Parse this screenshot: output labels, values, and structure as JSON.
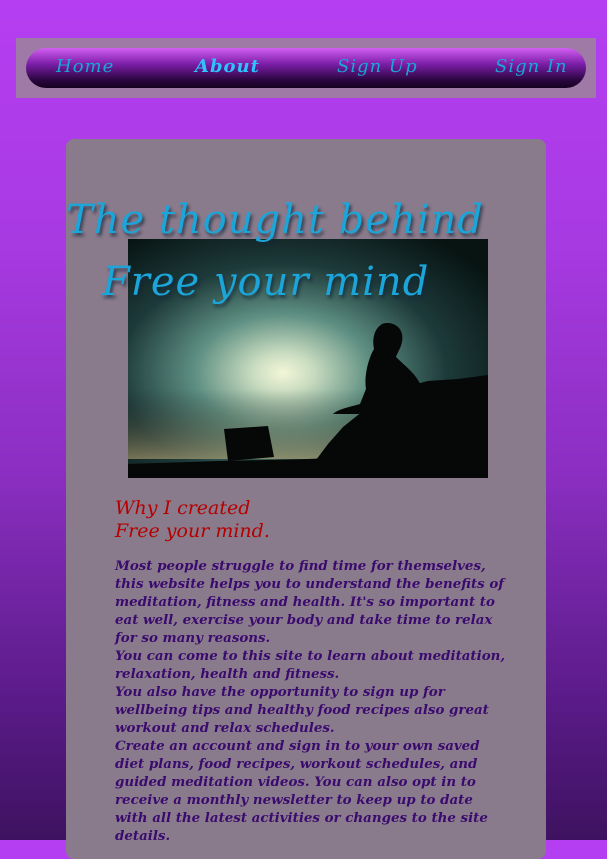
{
  "nav": {
    "items": [
      {
        "label": "Home",
        "active": false
      },
      {
        "label": "About",
        "active": true
      },
      {
        "label": "Sign Up",
        "active": false
      },
      {
        "label": "Sign In",
        "active": false
      }
    ]
  },
  "hero": {
    "title_line1": "The thought behind",
    "title_line2": "Free your mind"
  },
  "about": {
    "heading_line1": "Why I created",
    "heading_line2": "Free your mind.",
    "paragraphs": [
      "Most people struggle to find time for themselves, this website helps you to understand the benefits of meditation, fitness and health. It's so important to eat well, exercise your body and take time to relax for so many reasons.",
      "You can come to this site to learn about meditation, relaxation, health and fitness.",
      "You also have the opportunity to sign up for wellbeing tips and healthy food recipes also great workout and relax schedules.",
      "Create an account and sign in to your own saved diet plans, food recipes, workout schedules, and guided meditation videos. You can also opt in to receive a monthly newsletter to keep up to date with all the latest activities or changes to the site details."
    ]
  },
  "colors": {
    "nav_link": "#1aa6d6",
    "title_script": "#1ba5d8",
    "heading_red": "#b50000",
    "body_purple": "#3a0a6e",
    "card_bg": "#8a7b8c"
  }
}
